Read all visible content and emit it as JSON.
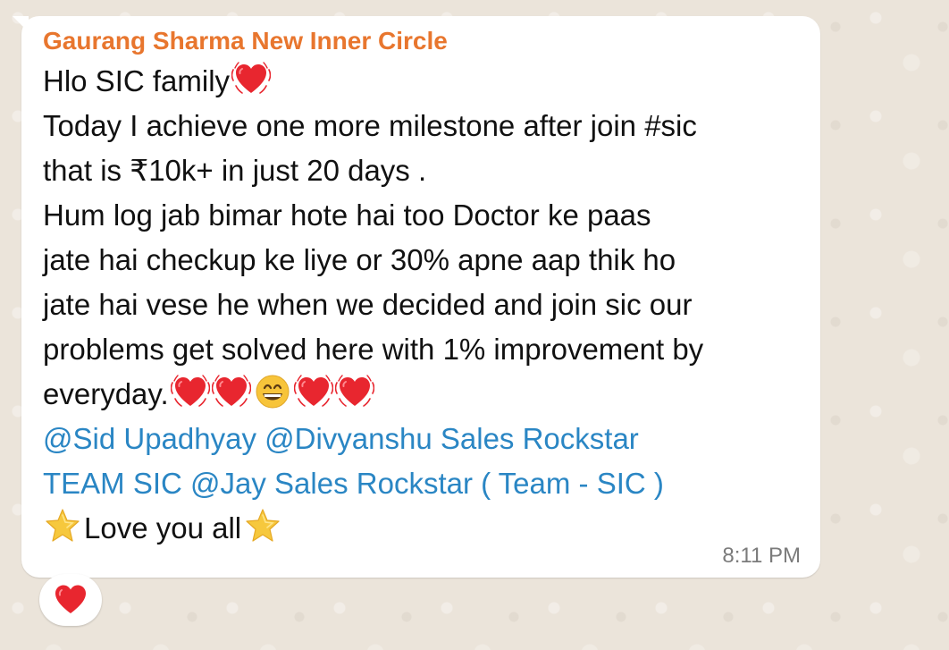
{
  "message": {
    "sender": "Gaurang Sharma New Inner Circle",
    "lines": [
      "Hlo SIC family",
      "Today I achieve one more milestone after join #sic",
      "that is ₹10k+ in just 20 days .",
      "Hum log jab bimar hote hai too Doctor ke paas",
      "jate hai checkup ke liye or 30% apne aap thik ho",
      "jate hai  vese he when we decided and join sic our",
      "problems get solved here with 1% improvement by",
      "everyday."
    ],
    "mentions": [
      "@Sid Upadhyay @Divyanshu Sales Rockstar",
      "TEAM SIC @Jay Sales Rockstar ( Team - SIC )"
    ],
    "closing": "Love you all",
    "time": "8:11 PM"
  },
  "emojis": {
    "heart_vibrating": "vibrating-heart-icon",
    "grin": "grinning-face-icon",
    "star": "glowing-star-icon",
    "reaction": "red-heart-icon"
  },
  "colors": {
    "sender": "#e8762e",
    "mention": "#2a86c4",
    "text": "#111111",
    "timestamp": "#7b7b7b",
    "background": "#ebe4da"
  }
}
